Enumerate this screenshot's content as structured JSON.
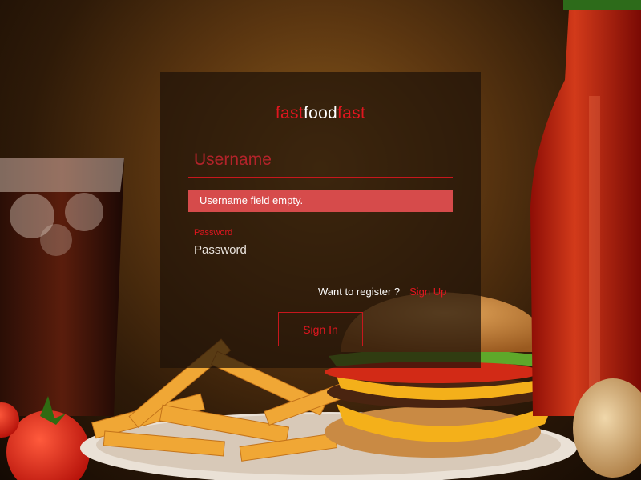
{
  "brand": {
    "part1": "fast",
    "part2": "food",
    "part3": "fast"
  },
  "login": {
    "username_placeholder": "Username",
    "username_value": "",
    "error_message": "Username field empty.",
    "password_label": "Password",
    "password_placeholder": "Password",
    "password_value": "",
    "register_prompt": "Want to register ?",
    "signup_link": "Sign Up",
    "signin_button": "Sign In"
  },
  "colors": {
    "accent": "#e0161f",
    "error_bg": "#d64b4b",
    "card_bg": "rgba(30,18,8,0.72)"
  },
  "background": {
    "depicts": [
      "cola-glass",
      "tomato",
      "french-fries",
      "burger",
      "ketchup-bottle",
      "onion"
    ]
  }
}
